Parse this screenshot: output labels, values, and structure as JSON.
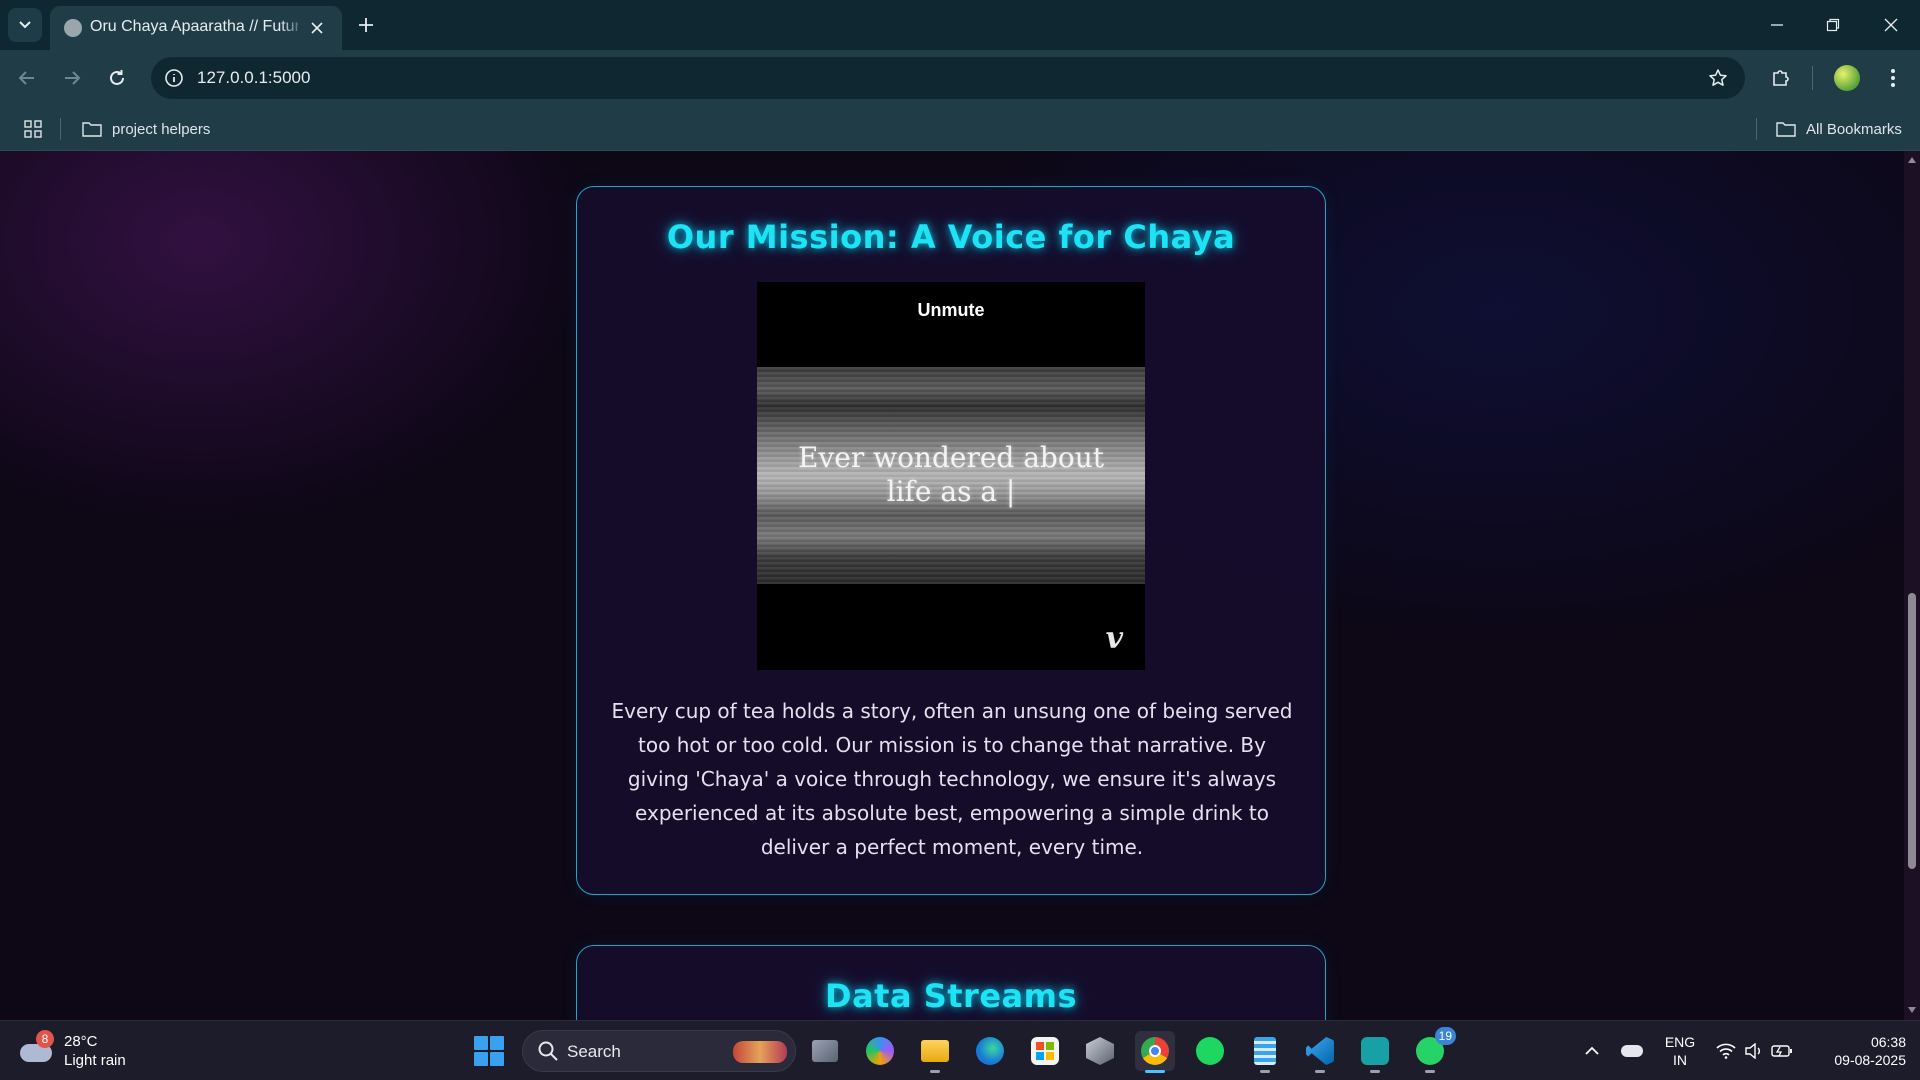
{
  "browser": {
    "tab_title": "Oru Chaya Apaaratha // Futuristic",
    "url": "127.0.0.1:5000",
    "bookmarks": [
      {
        "label": "project helpers"
      }
    ],
    "all_bookmarks_label": "All Bookmarks"
  },
  "page": {
    "mission": {
      "title": "Our Mission: A Voice for Chaya",
      "video": {
        "unmute_label": "Unmute",
        "caption_line1": "Ever wondered about",
        "caption_line2": "life as a |",
        "logo": "v"
      },
      "description": "Every cup of tea holds a story, often an unsung one of being served too hot or too cold. Our mission is to change that narrative. By giving 'Chaya' a voice through technology, we ensure it's always experienced at its absolute best, empowering a simple drink to deliver a perfect moment, every time."
    },
    "data_streams": {
      "title": "Data Streams"
    }
  },
  "taskbar": {
    "weather": {
      "badge": "8",
      "temp": "28°C",
      "condition": "Light rain"
    },
    "search_label": "Search",
    "whatsapp_badge": "19",
    "lang_line1": "ENG",
    "lang_line2": "IN",
    "time": "06:38",
    "date": "09-08-2025"
  },
  "colors": {
    "accent_cyan": "#1ee3f5",
    "card_border": "#1fa7c4",
    "page_bg": "#0d0716",
    "chrome_bg": "#1f3c47"
  }
}
